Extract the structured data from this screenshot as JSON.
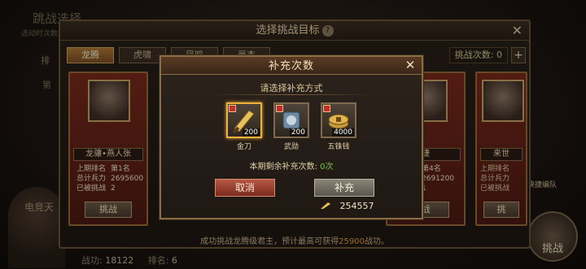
{
  "background": {
    "screen_title": "跳战选择",
    "screen_subtitle": "选动时次数本回",
    "rank_tab": "排",
    "level_text": "第",
    "corner_label": "电竞天",
    "bottom_stats": {
      "power_label": "战功:",
      "power_value": "18122",
      "rank_label": "排名:",
      "rank_value": "6"
    },
    "quick_label": "快捷编队",
    "big_button_label": "挑战"
  },
  "main_dialog": {
    "title": "选择挑战目标",
    "help_glyph": "?",
    "close_glyph": "✕",
    "tabs": [
      "龙腾",
      "虎啸",
      "凤鸣",
      "豪杰"
    ],
    "active_tab": 0,
    "challenge_count_label": "挑战次数:",
    "challenge_count_value": "0",
    "plus_glyph": "+",
    "footer_prefix": "成功挑战龙腾级君主，预计最高可获得",
    "footer_highlight": "25900",
    "footer_suffix": "战功。",
    "cards": [
      {
        "name": "龙骧•燕人张",
        "stats": [
          {
            "label": "上期排名",
            "value": "第1名"
          },
          {
            "label": "总计兵力",
            "value": "2695600"
          },
          {
            "label": "已被挑战",
            "value": "2"
          }
        ],
        "button": "挑战"
      },
      {
        "name": "捷",
        "stats": [
          {
            "label": "",
            "value": "第4名"
          },
          {
            "label": "",
            "value": "2691200"
          },
          {
            "label": "",
            "value": "1"
          }
        ],
        "button": "战"
      },
      {
        "name": "来世",
        "stats": [
          {
            "label": "上期排名",
            "value": ""
          },
          {
            "label": "总计兵力",
            "value": ""
          },
          {
            "label": "已被挑战",
            "value": ""
          }
        ],
        "button": "挑"
      }
    ]
  },
  "modal": {
    "title": "补充次数",
    "close_glyph": "✕",
    "prompt": "请选择补充方式",
    "items": [
      {
        "label": "金刀",
        "qty": "200",
        "icon": "golden-blade-icon",
        "selected": true
      },
      {
        "label": "武勋",
        "qty": "200",
        "icon": "military-merit-icon",
        "selected": false
      },
      {
        "label": "五铢钱",
        "qty": "4000",
        "icon": "coin-icon",
        "selected": false
      }
    ],
    "remaining_label": "本期剩余补充次数:",
    "remaining_value": "0次",
    "cancel_label": "取消",
    "confirm_label": "补充",
    "currency_value": "254557",
    "colors": {
      "selected_border": "#f0b23c",
      "remaining_value": "#79c24a",
      "cancel_button": "#b65846",
      "footer_highlight": "#e2a03a"
    }
  }
}
